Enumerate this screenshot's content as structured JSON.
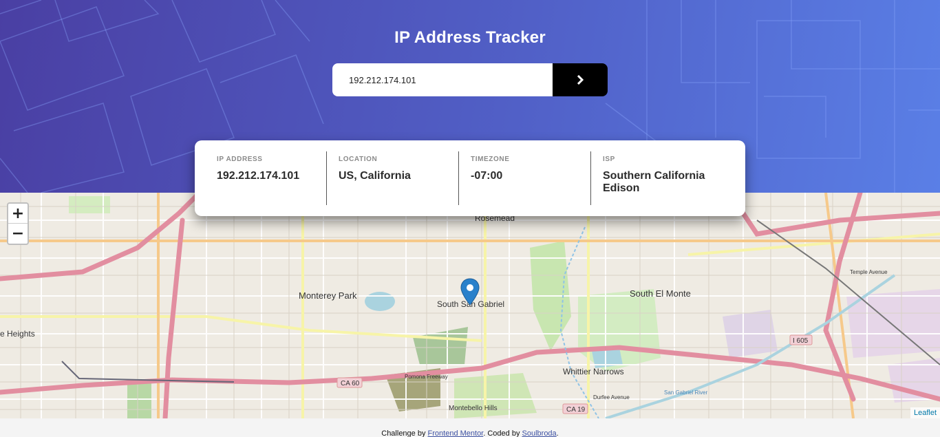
{
  "header": {
    "title": "IP Address Tracker",
    "search": {
      "value": "192.212.174.101",
      "placeholder": ""
    }
  },
  "info": [
    {
      "label": "IP ADDRESS",
      "value": "192.212.174.101"
    },
    {
      "label": "LOCATION",
      "value": "US, California"
    },
    {
      "label": "TIMEZONE",
      "value": "-07:00"
    },
    {
      "label": "ISP",
      "value": "Southern California Edison"
    }
  ],
  "map": {
    "zoom_in": "+",
    "zoom_out": "−",
    "attribution": "Leaflet",
    "place_labels": [
      "Rosemead",
      "Monterey Park",
      "South San Gabriel",
      "South El Monte",
      "Whittier Narrows",
      "e Heights",
      "Montebello Hills"
    ],
    "road_labels": [
      "CA 60",
      "CA 19",
      "I 605",
      "Pomona Freeway",
      "Durfee Avenue",
      "Temple Avenue",
      "San Gabriel River"
    ]
  },
  "footer": {
    "prefix": "Challenge by ",
    "link1": "Frontend Mentor",
    "middle": ". Coded by ",
    "link2": "Soulbroda",
    "suffix": "."
  },
  "colors": {
    "header_start": "#4a3fa3",
    "header_end": "#5a7fe6",
    "button": "#000000",
    "marker": "#2a81cb"
  }
}
